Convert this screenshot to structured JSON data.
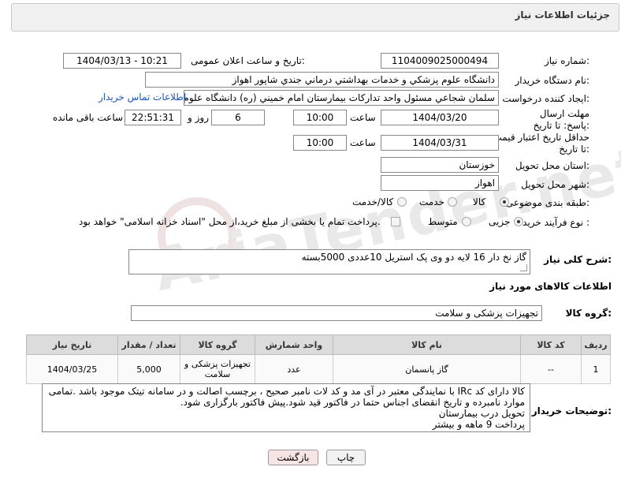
{
  "header": {
    "title": "جزئیات اطلاعات نیاز"
  },
  "watermark": {
    "text": "AriaTender.net"
  },
  "form": {
    "need_number_label": "شماره نیاز:",
    "need_number": "1104009025000494",
    "announce_label": "تاریخ و ساعت اعلان عمومی:",
    "announce_value": "1404/03/13 - 10:21",
    "buyer_org_label": "نام دستگاه خریدار:",
    "buyer_org": "دانشگاه علوم پزشکي و خدمات بهداشتي درماني جندي شاپور اهواز",
    "requester_label": "ایجاد کننده درخواست:",
    "requester": "سلمان شجاعي مسئول واحد تدارکات بيمارستان امام خميني (ره) دانشگاه علوم",
    "contact_link": "اطلاعات تماس خریدار",
    "reply_deadline_label": "مهلت ارسال پاسخ: تا تاریخ:",
    "reply_date": "1404/03/20",
    "time_label": "ساعت",
    "reply_time": "10:00",
    "days_value": "6",
    "days_label": "روز و",
    "remaining_time": "22:51:31",
    "remaining_label": "ساعت باقی مانده",
    "price_valid_label": "حداقل تاریخ اعتبار قیمت: تا تاریخ:",
    "price_date": "1404/03/31",
    "price_time_label": "ساعت",
    "price_time": "10:00",
    "province_label": "استان محل تحویل:",
    "province": "خوزستان",
    "city_label": "شهر محل تحویل:",
    "city": "اهواز",
    "category_label": "طبقه بندی موضوعی:",
    "category_options": [
      "کالا",
      "خدمت",
      "کالا/خدمت"
    ],
    "process_label": "نوع فرآیند خرید :",
    "process_options": [
      "جزیی",
      "متوسط"
    ],
    "payment_note": "پرداخت تمام یا بخشی از مبلغ خرید،از محل \"اسناد خزانه اسلامی\" خواهد بود.",
    "description_label": "شرح کلی نیاز:",
    "description": "گاز نخ دار 16 لایه دو وی پک استریل 10عددی 5000بسته",
    "goods_info_title": "اطلاعات کالاهای مورد نیاز",
    "goods_group_label": "گروه کالا:",
    "goods_group": "تجهیزات پزشکی و سلامت"
  },
  "table": {
    "headers": [
      "ردیف",
      "کد کالا",
      "نام کالا",
      "واحد شمارش",
      "گروه کالا",
      "تعداد / مقدار",
      "تاریخ نیاز"
    ],
    "rows": [
      [
        "1",
        "--",
        "گاز پانسمان",
        "عدد",
        "تجهیزات پزشکی و سلامت",
        "5,000",
        "1404/03/25"
      ]
    ]
  },
  "buyer_notes": {
    "label": "توضیحات خریدار:",
    "lines": [
      "کالا دارای کد IRc با نمایندگی معتبر در آی مد و کد لات نامبر صحیح ، برچسب اصالت و در سامانه تیتک موجود باشد .تمامی",
      "موارد نامبرده و تاریخ انقضای اجناس حتما در فاکتور قید شود.پیش فاکتور بارگزاری شود.",
      "تحویل درب بیمارستان",
      "پرداخت 9 ماهه و بیشتر"
    ]
  },
  "buttons": {
    "print": "چاپ",
    "back": "بازگشت"
  }
}
